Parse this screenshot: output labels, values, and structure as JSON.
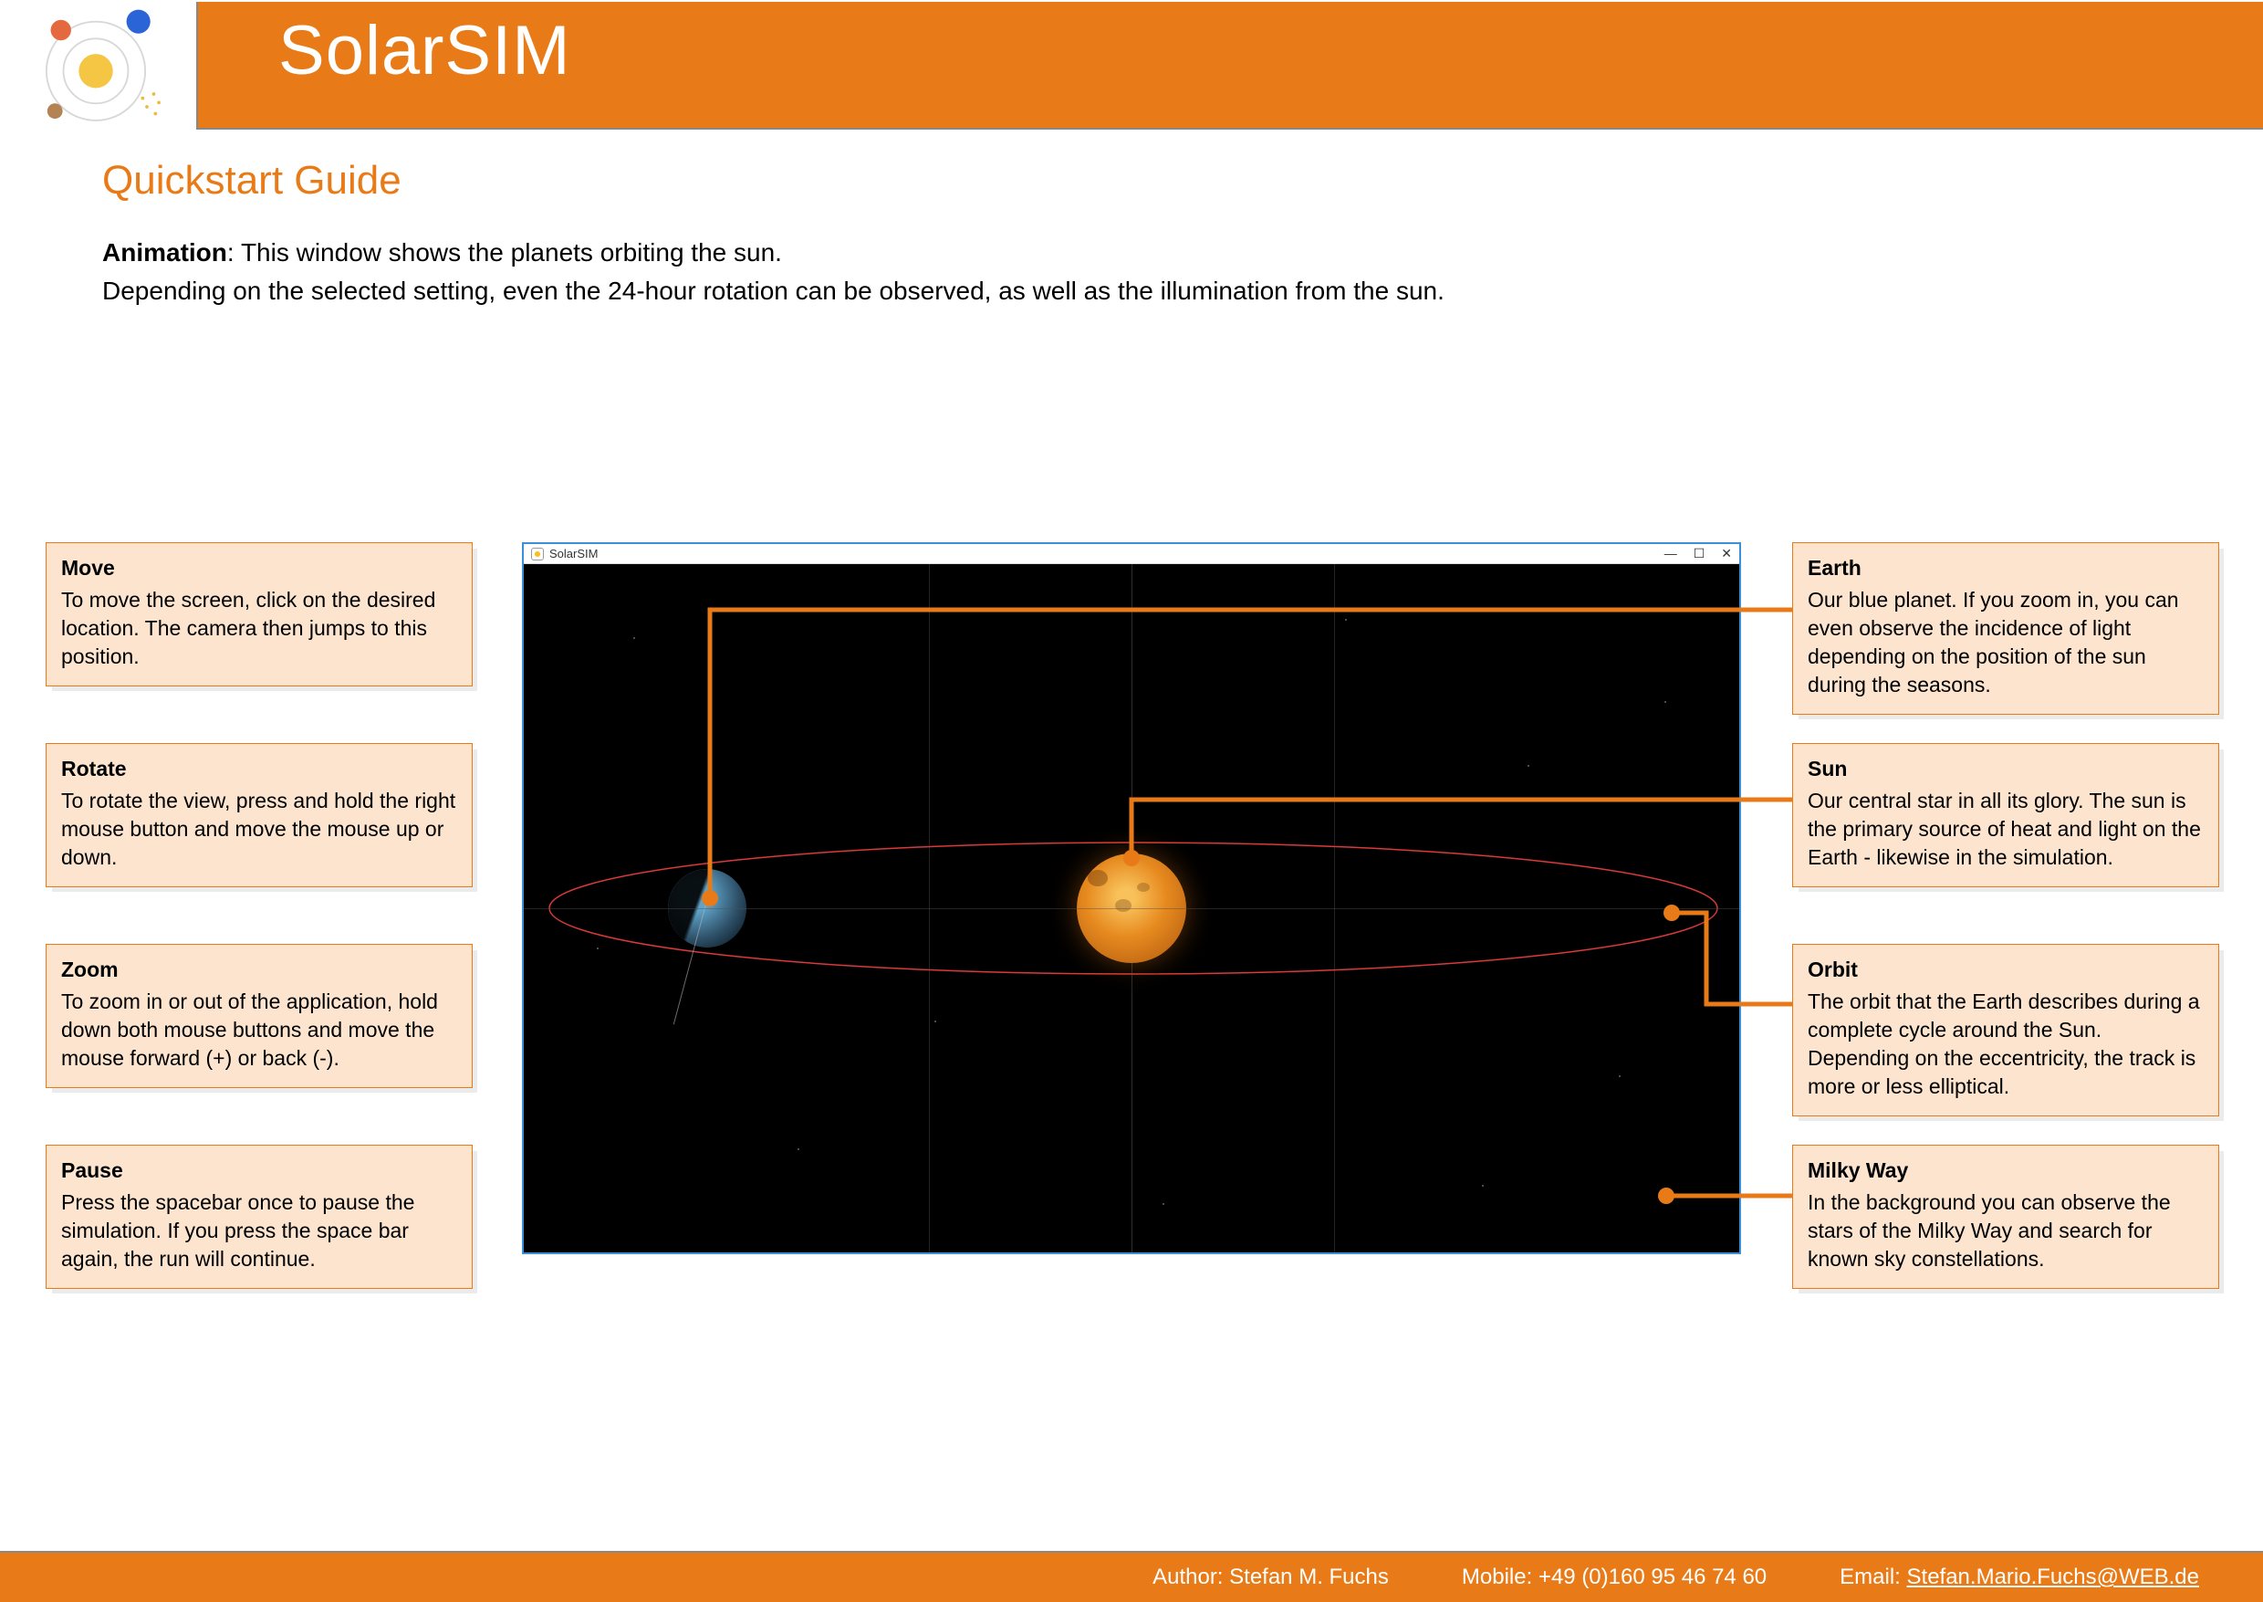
{
  "header": {
    "app_name": "SolarSIM"
  },
  "page": {
    "title": "Quickstart Guide",
    "intro_bold": "Animation",
    "intro_line1_rest": ": This window shows the planets orbiting the sun.",
    "intro_line2": "Depending on the selected setting, even the 24-hour rotation can be observed, as well as the illumination from the sun."
  },
  "sim": {
    "window_title": "SolarSIM",
    "minimize_glyph": "—",
    "maximize_glyph": "☐",
    "close_glyph": "✕"
  },
  "callouts": {
    "move": {
      "title": "Move",
      "body": "To move the screen, click on the desired location. The camera then jumps to this position."
    },
    "rotate": {
      "title": "Rotate",
      "body": "To rotate the view, press and hold the right mouse button and move the mouse up or down."
    },
    "zoom": {
      "title": "Zoom",
      "body": "To zoom in or out of the application, hold down both mouse buttons and move the mouse forward (+) or back (-)."
    },
    "pause": {
      "title": "Pause",
      "body": "Press the spacebar once to pause the simulation. If you press the space bar again, the run will continue."
    },
    "earth": {
      "title": "Earth",
      "body": "Our blue planet. If you zoom in, you can even observe the incidence of light depending on the position of the sun during the seasons."
    },
    "sun": {
      "title": "Sun",
      "body": "Our central star in all its glory. The sun is the primary source of heat and light on the Earth - likewise in the simulation."
    },
    "orbit": {
      "title": "Orbit",
      "body": "The orbit that the Earth describes during a complete cycle around the Sun. Depending on the eccentricity, the track is more or less elliptical."
    },
    "milky": {
      "title": "Milky Way",
      "body": "In the background you can observe the stars of the Milky Way and search for known sky constellations."
    }
  },
  "footer": {
    "author_label": "Author: ",
    "author": "Stefan M. Fuchs",
    "mobile_label": "Mobile: ",
    "mobile": "+49 (0)160 95 46 74 60",
    "email_label": "Email: ",
    "email": "Stefan.Mario.Fuchs@WEB.de"
  }
}
